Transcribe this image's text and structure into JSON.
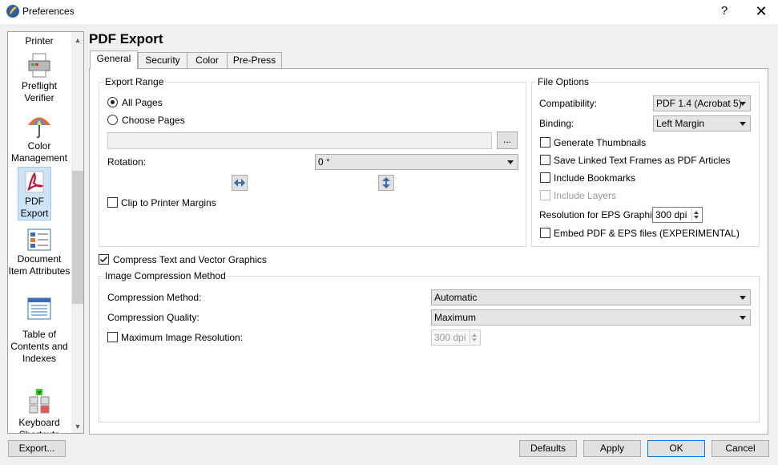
{
  "window": {
    "title": "Preferences",
    "help": "?",
    "close": "✕"
  },
  "sidebar": {
    "items": [
      {
        "label": "Printer"
      },
      {
        "label": "Preflight Verifier"
      },
      {
        "label": "Color Management"
      },
      {
        "label": "PDF Export"
      },
      {
        "label": "Document Item Attributes"
      },
      {
        "label": "Table of Contents and Indexes"
      },
      {
        "label": "Keyboard Shortcuts"
      }
    ],
    "selected": "PDF Export"
  },
  "page_title": "PDF Export",
  "tabs": [
    {
      "label": "General"
    },
    {
      "label": "Security"
    },
    {
      "label": "Color"
    },
    {
      "label": "Pre-Press"
    }
  ],
  "export_range": {
    "title": "Export Range",
    "all_pages": "All Pages",
    "choose_pages": "Choose Pages",
    "browse": "...",
    "rotation_label": "Rotation:",
    "rotation_value": "0 °",
    "clip_label": "Clip to Printer Margins"
  },
  "file_options": {
    "title": "File Options",
    "compatibility_label": "Compatibility:",
    "compatibility_value": "PDF 1.4 (Acrobat 5)",
    "binding_label": "Binding:",
    "binding_value": "Left Margin",
    "generate_thumbnails": "Generate Thumbnails",
    "save_linked": "Save Linked Text Frames as PDF Articles",
    "include_bookmarks": "Include Bookmarks",
    "include_layers": "Include Layers",
    "resolution_label": "Resolution for EPS Graphics:",
    "resolution_value": "300 dpi",
    "embed_label": "Embed PDF & EPS files (EXPERIMENTAL)"
  },
  "compress": {
    "label": "Compress Text and Vector Graphics",
    "checked": true
  },
  "image_compression": {
    "title": "Image Compression Method",
    "method_label": "Compression Method:",
    "method_value": "Automatic",
    "quality_label": "Compression Quality:",
    "quality_value": "Maximum",
    "max_res_label": "Maximum Image Resolution:",
    "max_res_value": "300 dpi"
  },
  "buttons": {
    "export": "Export...",
    "defaults": "Defaults",
    "apply": "Apply",
    "ok": "OK",
    "cancel": "Cancel"
  },
  "colors": {
    "selection": "#cde3f7",
    "accent": "#0078d7"
  }
}
